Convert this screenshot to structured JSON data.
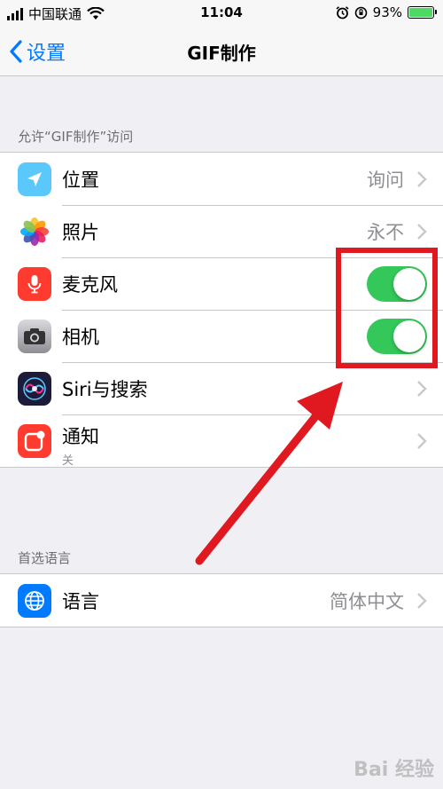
{
  "status_bar": {
    "carrier": "中国联通",
    "time": "11:04",
    "battery": "93%",
    "icons": [
      "signal-icon",
      "wifi-icon",
      "alarm-icon",
      "orientation-lock-icon",
      "battery-icon"
    ]
  },
  "nav": {
    "back_label": "设置",
    "title": "GIF制作"
  },
  "section_access": {
    "header": "允许“GIF制作”访问",
    "rows": [
      {
        "label": "位置",
        "value": "询问",
        "icon": "location-icon",
        "icon_color": "#5ac8fa"
      },
      {
        "label": "照片",
        "value": "永不",
        "icon": "photos-icon",
        "icon_color": "#ffffff"
      },
      {
        "label": "麦克风",
        "toggle": true,
        "icon": "microphone-icon",
        "icon_color": "#ff3b30"
      },
      {
        "label": "相机",
        "toggle": true,
        "icon": "camera-icon",
        "icon_color": "#8e8e93"
      },
      {
        "label": "Siri与搜索",
        "icon": "siri-icon",
        "icon_color": "#1c1c3a"
      },
      {
        "label": "通知",
        "sub": "关",
        "icon": "notifications-icon",
        "icon_color": "#ff3b30"
      }
    ]
  },
  "section_language": {
    "header": "首选语言",
    "rows": [
      {
        "label": "语言",
        "value": "简体中文",
        "icon": "globe-icon",
        "icon_color": "#007aff"
      }
    ]
  },
  "toggle_color": "#34c759",
  "highlight_color": "#e0181f",
  "watermark": "Bai 经验"
}
